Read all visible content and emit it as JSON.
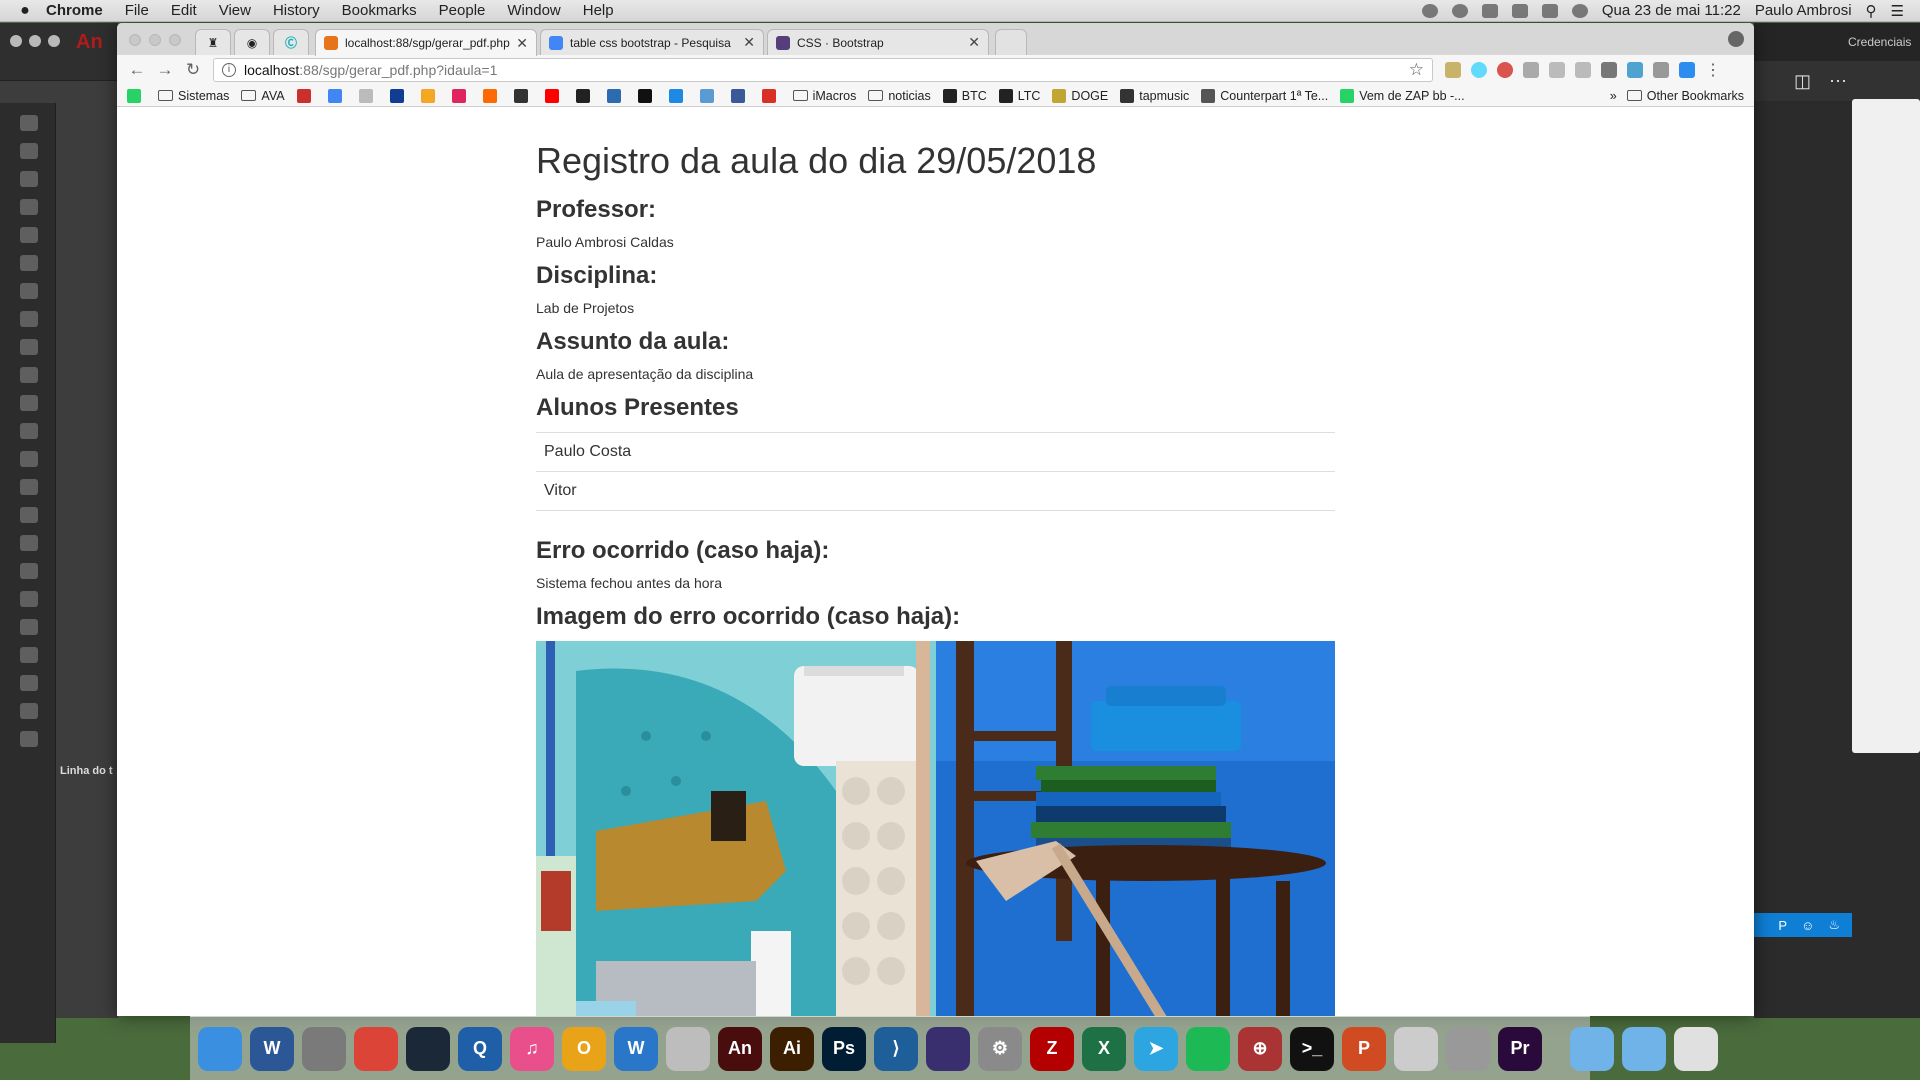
{
  "menubar": {
    "app": "Chrome",
    "items": [
      "File",
      "Edit",
      "View",
      "History",
      "Bookmarks",
      "People",
      "Window",
      "Help"
    ],
    "datetime": "Qua 23 de mai  11:22",
    "user": "Paulo Ambrosi"
  },
  "animate": {
    "logo": "An",
    "timeline_label": "Linha do t"
  },
  "rightapp": {
    "header": "Credenciais",
    "bottom_label": "P"
  },
  "browser": {
    "tabs": [
      {
        "title": "localhost:88/sgp/gerar_pdf.php",
        "favicon_color": "#e8731d",
        "active": true
      },
      {
        "title": "table css bootstrap - Pesquisa",
        "favicon_color": "#4285f4",
        "active": false
      },
      {
        "title": "CSS · Bootstrap",
        "favicon_color": "#563d7c",
        "active": false
      }
    ],
    "address": {
      "host": "localhost",
      "path": ":88/sgp/gerar_pdf.php?idaula=1"
    },
    "bookmarks": [
      {
        "label": "",
        "kind": "icon",
        "color": "#25d366"
      },
      {
        "label": "Sistemas",
        "kind": "folder"
      },
      {
        "label": "AVA",
        "kind": "folder"
      },
      {
        "label": "",
        "kind": "icon",
        "color": "#c9302c"
      },
      {
        "label": "",
        "kind": "icon",
        "color": "#4285f4"
      },
      {
        "label": "",
        "kind": "icon",
        "color": "#bbbbbb"
      },
      {
        "label": "",
        "kind": "icon",
        "color": "#0f3d91"
      },
      {
        "label": "",
        "kind": "icon",
        "color": "#f5a623"
      },
      {
        "label": "",
        "kind": "icon",
        "color": "#e0245e"
      },
      {
        "label": "",
        "kind": "icon",
        "color": "#ff6a00"
      },
      {
        "label": "",
        "kind": "icon",
        "color": "#333333"
      },
      {
        "label": "",
        "kind": "icon",
        "color": "#ff0000"
      },
      {
        "label": "",
        "kind": "icon",
        "color": "#222222"
      },
      {
        "label": "",
        "kind": "icon",
        "color": "#2b6cb0"
      },
      {
        "label": "",
        "kind": "icon",
        "color": "#111111"
      },
      {
        "label": "",
        "kind": "icon",
        "color": "#1e88e5"
      },
      {
        "label": "",
        "kind": "icon",
        "color": "#5b9bd5"
      },
      {
        "label": "",
        "kind": "icon",
        "color": "#3b5998"
      },
      {
        "label": "",
        "kind": "icon",
        "color": "#d93025"
      },
      {
        "label": "iMacros",
        "kind": "folder"
      },
      {
        "label": "noticias",
        "kind": "folder"
      },
      {
        "label": "BTC",
        "kind": "icon",
        "color": "#222222"
      },
      {
        "label": "LTC",
        "kind": "icon",
        "color": "#222222"
      },
      {
        "label": "DOGE",
        "kind": "icon",
        "color": "#c2a633"
      },
      {
        "label": "tapmusic",
        "kind": "icon",
        "color": "#333333"
      },
      {
        "label": "Counterpart 1ª Te...",
        "kind": "icon",
        "color": "#555555"
      },
      {
        "label": "Vem de ZAP bb -...",
        "kind": "icon",
        "color": "#25d366"
      }
    ],
    "bookmarks_more": "»",
    "other_bookmarks": "Other Bookmarks"
  },
  "page": {
    "title": "Registro da aula do dia 29/05/2018",
    "sections": [
      {
        "heading": "Professor:",
        "value": "Paulo Ambrosi Caldas"
      },
      {
        "heading": "Disciplina:",
        "value": "Lab de Projetos"
      },
      {
        "heading": "Assunto da aula:",
        "value": "Aula de apresentação da disciplina"
      }
    ],
    "students_heading": "Alunos Presentes",
    "students": [
      "Paulo Costa",
      "Vitor"
    ],
    "error_heading": "Erro ocorrido (caso haja):",
    "error_value": "Sistema fechou antes da hora",
    "image_heading": "Imagem do erro ocorrido (caso haja):"
  },
  "dock": {
    "apps": [
      {
        "name": "finder",
        "color": "#3b8fe0",
        "label": ""
      },
      {
        "name": "word",
        "color": "#2b5797",
        "label": "W"
      },
      {
        "name": "system-preferences",
        "color": "#7a7a7a",
        "label": ""
      },
      {
        "name": "chrome",
        "color": "#db4437",
        "label": ""
      },
      {
        "name": "steam",
        "color": "#1b2838",
        "label": ""
      },
      {
        "name": "quicktime",
        "color": "#1f5fa8",
        "label": "Q"
      },
      {
        "name": "itunes",
        "color": "#e94f8a",
        "label": "♫"
      },
      {
        "name": "opera",
        "color": "#e8a318",
        "label": "O"
      },
      {
        "name": "wireshark-like",
        "color": "#2a77c9",
        "label": "W"
      },
      {
        "name": "folder-app",
        "color": "#bdbdbd",
        "label": ""
      },
      {
        "name": "animate",
        "color": "#4a0d0d",
        "label": "An"
      },
      {
        "name": "illustrator",
        "color": "#3b1f00",
        "label": "Ai"
      },
      {
        "name": "photoshop",
        "color": "#001d34",
        "label": "Ps"
      },
      {
        "name": "vscode",
        "color": "#1e5f99",
        "label": "⟩"
      },
      {
        "name": "media-app",
        "color": "#3a2f6e",
        "label": ""
      },
      {
        "name": "settings-gear",
        "color": "#8a8a8a",
        "label": "⚙"
      },
      {
        "name": "filezilla",
        "color": "#b40000",
        "label": "Z"
      },
      {
        "name": "excel-x",
        "color": "#1e7145",
        "label": "X"
      },
      {
        "name": "telegram",
        "color": "#2ca5e0",
        "label": "➤"
      },
      {
        "name": "spotify",
        "color": "#1db954",
        "label": ""
      },
      {
        "name": "target-app",
        "color": "#a33",
        "label": "⊕"
      },
      {
        "name": "terminal",
        "color": "#111111",
        "label": ">_"
      },
      {
        "name": "presentation-p",
        "color": "#d14b22",
        "label": "P"
      },
      {
        "name": "clock-app",
        "color": "#cccccc",
        "label": ""
      },
      {
        "name": "utility-app",
        "color": "#999999",
        "label": ""
      },
      {
        "name": "premiere",
        "color": "#2a0a3b",
        "label": "Pr"
      }
    ],
    "right_items": [
      {
        "name": "downloads-folder",
        "color": "#6fb3e8"
      },
      {
        "name": "applications-folder",
        "color": "#6fb3e8"
      },
      {
        "name": "trash",
        "color": "#e0e0e0"
      }
    ]
  }
}
